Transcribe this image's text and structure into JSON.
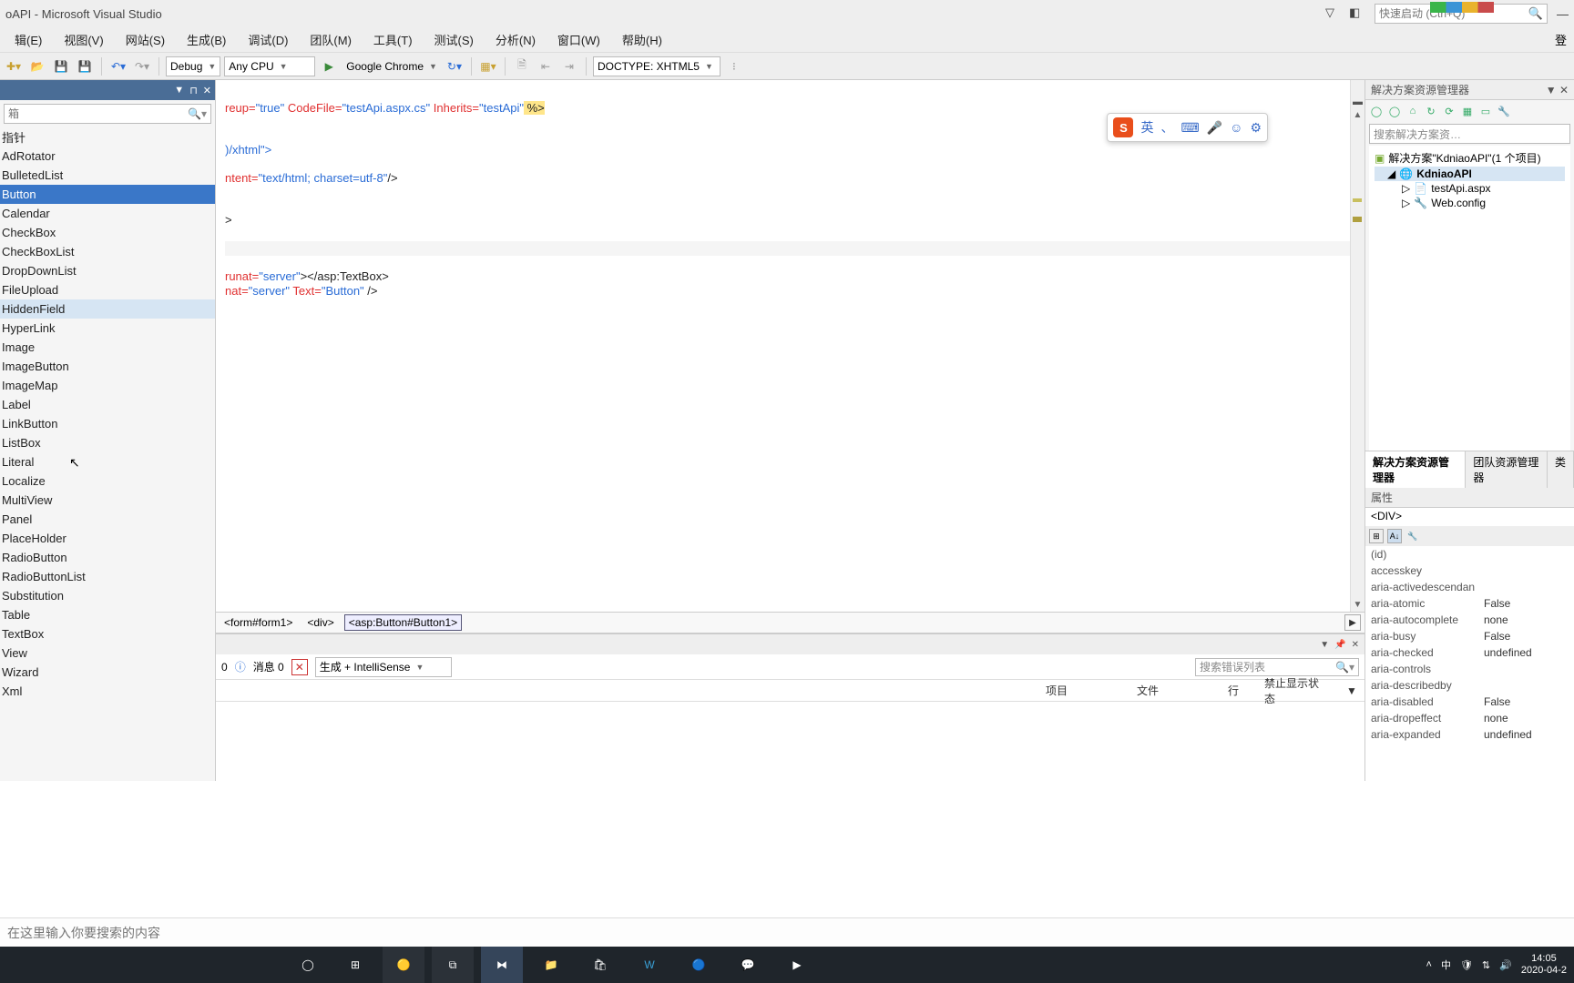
{
  "title": "oAPI - Microsoft Visual Studio",
  "quick_launch": {
    "placeholder": "快速启动 (Ctrl+Q)"
  },
  "menu": [
    "辑(E)",
    "视图(V)",
    "网站(S)",
    "生成(B)",
    "调试(D)",
    "团队(M)",
    "工具(T)",
    "测试(S)",
    "分析(N)",
    "窗口(W)",
    "帮助(H)"
  ],
  "login_label": "登",
  "toolbar": {
    "config": "Debug",
    "platform": "Any CPU",
    "run_target": "Google Chrome",
    "doctype": "DOCTYPE: XHTML5"
  },
  "toolbox": {
    "search_placeholder": "箱",
    "items": [
      "指针",
      "AdRotator",
      "BulletedList",
      "Button",
      "Calendar",
      "CheckBox",
      "CheckBoxList",
      "DropDownList",
      "FileUpload",
      "HiddenField",
      "HyperLink",
      "Image",
      "ImageButton",
      "ImageMap",
      "Label",
      "LinkButton",
      "ListBox",
      "Literal",
      "Localize",
      "MultiView",
      "Panel",
      "PlaceHolder",
      "RadioButton",
      "RadioButtonList",
      "Substitution",
      "Table",
      "TextBox",
      "View",
      "Wizard",
      "Xml"
    ],
    "selected": "Button",
    "hover": "HiddenField"
  },
  "code": {
    "l1a": "reup=",
    "l1b": "\"true\"",
    "l1c": " CodeFile=",
    "l1d": "\"testApi.aspx.cs\"",
    "l1e": " Inherits=",
    "l1f": "\"testApi\"",
    "l1g": " %>",
    "l2": ")/xhtml\">",
    "l3a": "ntent=",
    "l3b": "\"text/html; charset=utf-8\"",
    "l3c": "/>",
    "l4": ">",
    "l5a": "runat=",
    "l5b": "\"server\"",
    "l5c": "></asp:TextBox>",
    "l6a": "nat=",
    "l6b": "\"server\"",
    "l6c": " Text=",
    "l6d": "\"Button\"",
    "l6e": " />"
  },
  "breadcrumb": [
    "<form#form1>",
    "<div>",
    "<asp:Button#Button1>"
  ],
  "errlist": {
    "count0": "0",
    "msg_label": "消息 0",
    "build_mode": "生成 + IntelliSense",
    "search": "搜索错误列表",
    "cols": {
      "proj": "项目",
      "file": "文件",
      "line": "行",
      "suppress": "禁止显示状态"
    }
  },
  "solution": {
    "title": "解决方案资源管理器",
    "search": "搜索解决方案资…",
    "root": "解决方案\"KdniaoAPI\"(1 个项目)",
    "proj": "KdniaoAPI",
    "files": [
      "testApi.aspx",
      "Web.config"
    ],
    "tabs": [
      "解决方案资源管理器",
      "团队资源管理器",
      "类"
    ]
  },
  "properties": {
    "title": "属性",
    "element": "<DIV>",
    "rows": [
      {
        "k": "(id)",
        "v": ""
      },
      {
        "k": "accesskey",
        "v": ""
      },
      {
        "k": "aria-activedescendan",
        "v": ""
      },
      {
        "k": "aria-atomic",
        "v": "False"
      },
      {
        "k": "aria-autocomplete",
        "v": "none"
      },
      {
        "k": "aria-busy",
        "v": "False"
      },
      {
        "k": "aria-checked",
        "v": "undefined"
      },
      {
        "k": "aria-controls",
        "v": ""
      },
      {
        "k": "aria-describedby",
        "v": ""
      },
      {
        "k": "aria-disabled",
        "v": "False"
      },
      {
        "k": "aria-dropeffect",
        "v": "none"
      },
      {
        "k": "aria-expanded",
        "v": "undefined"
      }
    ]
  },
  "ime": {
    "lang": "英"
  },
  "win_search": "在这里输入你要搜索的内容",
  "taskbar": {
    "time": "14:05",
    "date": "2020-04-2"
  }
}
